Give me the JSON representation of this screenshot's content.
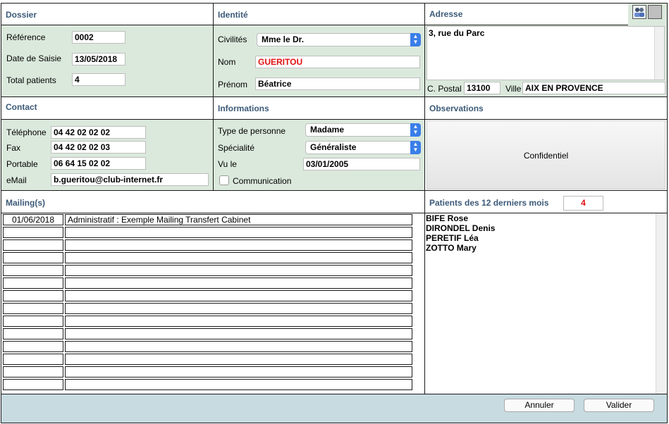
{
  "dossier": {
    "title": "Dossier",
    "reference_label": "Référence",
    "reference_value": "0002",
    "date_label": "Date de Saisie",
    "date_value": "13/05/2018",
    "total_label": "Total patients",
    "total_value": "4"
  },
  "identite": {
    "title": "Identité",
    "civilites_label": "Civilités",
    "civilites_value": "Mme le Dr.",
    "nom_label": "Nom",
    "nom_value": "GUERITOU",
    "prenom_label": "Prénom",
    "prenom_value": "Béatrice"
  },
  "adresse": {
    "title": "Adresse",
    "address_value": "3, rue du Parc",
    "cp_label": "C. Postal",
    "cp_value": "13100",
    "ville_label": "Ville",
    "ville_value": "AIX EN PROVENCE"
  },
  "contact": {
    "title": "Contact",
    "telephone_label": "Téléphone",
    "telephone_value": "04 42 02 02 02",
    "fax_label": "Fax",
    "fax_value": "04 42 02 02 03",
    "portable_label": "Portable",
    "portable_value": "06 64 15 02 02",
    "email_label": "eMail",
    "email_value": "b.gueritou@club-internet.fr"
  },
  "informations": {
    "title": "Informations",
    "type_label": "Type de personne",
    "type_value": "Madame",
    "specialite_label": "Spécialité",
    "specialite_value": "Généraliste",
    "vule_label": "Vu le",
    "vule_value": "03/01/2005",
    "communication_label": "Communication",
    "communication_checked": false
  },
  "observations": {
    "title": "Observations",
    "confidentiel_label": "Confidentiel"
  },
  "mailings": {
    "title": "Mailing(s)",
    "rows": [
      {
        "date": "01/06/2018",
        "text": "Administratif : Exemple Mailing Transfert Cabinet"
      }
    ]
  },
  "patients": {
    "title": "Patients des 12 derniers mois",
    "count": "4",
    "list": [
      "BIFE Rose",
      "DIRONDEL Denis",
      "PERETIF Léa",
      "ZOTTO Mary"
    ]
  },
  "footer": {
    "annuler_label": "Annuler",
    "valider_label": "Valider"
  },
  "colors": {
    "panel_green": "#dbe9dc",
    "footer_blue": "#c7dbe0",
    "heading_blue": "#3c5a78",
    "accent_red": "#e01010",
    "select_blue": "#3a7ee8"
  },
  "icons": {
    "people_icon": "people-icon",
    "blank_square": "square-icon"
  }
}
